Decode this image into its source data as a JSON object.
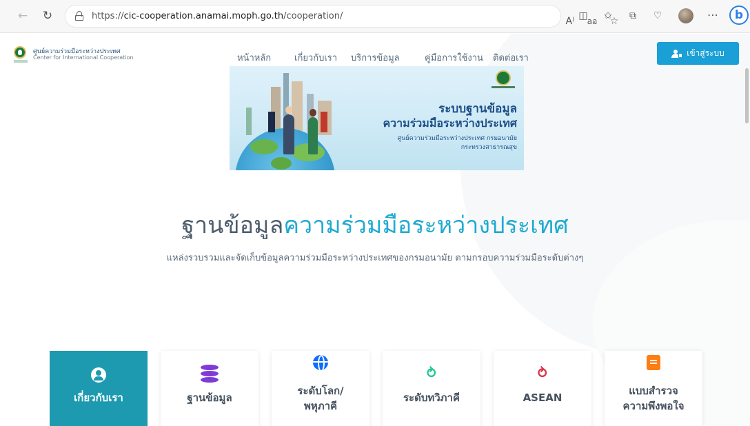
{
  "browser": {
    "url_prefix": "https://",
    "url_domain": "cic-cooperation.anamai.moph.go.th",
    "url_path": "/cooperation/",
    "read_aloud": "A⁾",
    "translate": "aอ"
  },
  "header": {
    "logo_th": "ศูนย์ความร่วมมือระหว่างประเทศ",
    "logo_en": "Center for International Cooperation",
    "menu": [
      "หน้าหลัก",
      "เกี่ยวกับเรา",
      "บริการข้อมูล",
      "คู่มือการใช้งาน",
      "ติดต่อเรา"
    ],
    "login_label": "เข้าสู่ระบบ"
  },
  "banner": {
    "title_line1": "ระบบฐานข้อมูล",
    "title_line2": "ความร่วมมือระหว่างประเทศ",
    "org_line1": "ศูนย์ความร่วมมือระหว่างประเทศ กรมอนามัย",
    "org_line2": "กระทรวงสาธารณสุข"
  },
  "hero": {
    "title_dark": "ฐานข้อมูล",
    "title_accent": "ความร่วมมือระหว่างประเทศ",
    "subtitle": "แหล่งรวบรวมและจัดเก็บข้อมูลความร่วมมือระหว่างประเทศของกรมอนามัย ตามกรอบความร่วมมือระดับต่างๆ"
  },
  "cards": [
    {
      "label": "เกี่ยวกับเรา",
      "icon": "person-circle-icon",
      "active": true
    },
    {
      "label": "ฐานข้อมูล",
      "icon": "database-icon",
      "color": "#7e3bd6"
    },
    {
      "label_line1": "ระดับโลก/",
      "label_line2": "พหุภาคี",
      "icon": "globe-icon",
      "color": "#0d6efd"
    },
    {
      "label": "ระดับทวิภาคี",
      "icon": "handshake-icon",
      "color": "#20c997"
    },
    {
      "label": "ASEAN",
      "icon": "handshake-icon",
      "color": "#dc3545"
    },
    {
      "label_line1": "แบบสำรวจ",
      "label_line2": "ความพึงพอใจ",
      "icon": "survey-icon",
      "color": "#fd7e14"
    }
  ],
  "colors": {
    "accent": "#1faad1",
    "active_card": "#1d9ab0",
    "login": "#1a9fd6"
  }
}
